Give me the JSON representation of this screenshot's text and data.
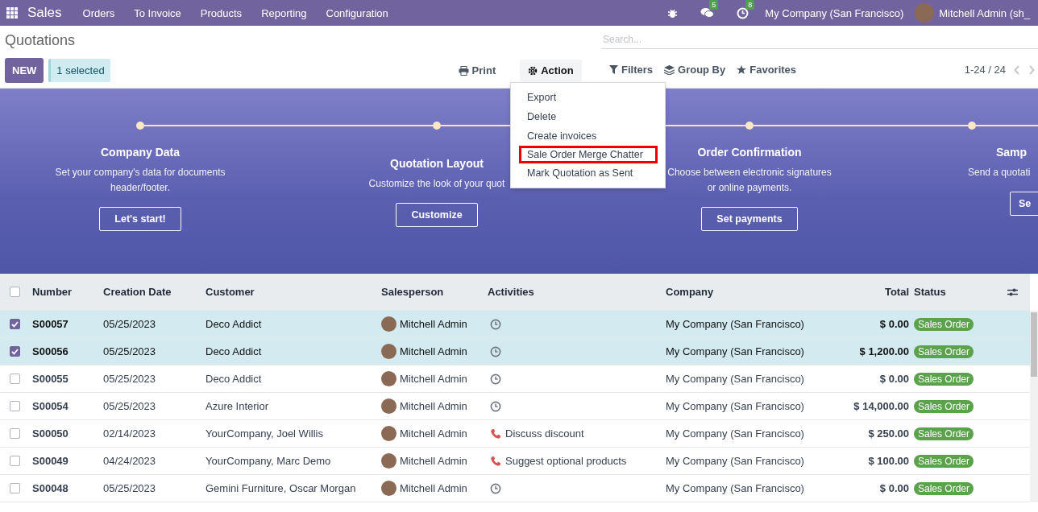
{
  "navbar": {
    "app": "Sales",
    "menus": [
      "Orders",
      "To Invoice",
      "Products",
      "Reporting",
      "Configuration"
    ],
    "messages_badge": "5",
    "activities_badge": "8",
    "company": "My Company (San Francisco)",
    "user": "Mitchell Admin (sh_"
  },
  "control_panel": {
    "title": "Quotations",
    "new_button": "NEW",
    "selection": "1 selected",
    "print": "Print",
    "action": "Action",
    "search": {
      "placeholder": "Search..."
    },
    "filters": "Filters",
    "group_by": "Group By",
    "favorites": "Favorites",
    "pager": "1-24 / 24"
  },
  "action_menu": [
    {
      "label": "Export",
      "outlined": false
    },
    {
      "label": "Delete",
      "outlined": false
    },
    {
      "label": "Create invoices",
      "outlined": false
    },
    {
      "label": "Sale Order Merge Chatter",
      "outlined": true
    },
    {
      "label": "Mark Quotation as Sent",
      "outlined": false
    }
  ],
  "onboarding": [
    {
      "title": "Company Data",
      "description": "Set your company's data for documents header/footer.",
      "button": "Let's start!"
    },
    {
      "title": "Quotation Layout",
      "description": "Customize the look of your quot",
      "button": "Customize"
    },
    {
      "title": "Order Confirmation",
      "description": "Choose between electronic signatures or online payments.",
      "button": "Set payments"
    },
    {
      "title": "Samp",
      "description": "Send a quotati",
      "button": "Se"
    }
  ],
  "table": {
    "columns": [
      "Number",
      "Creation Date",
      "Customer",
      "Salesperson",
      "Activities",
      "Company",
      "Total",
      "Status"
    ],
    "all_checked": false,
    "rows": [
      {
        "number": "S00057",
        "date": "05/25/2023",
        "customer": "Deco Addict",
        "salesperson": "Mitchell Admin",
        "kind": "clock",
        "activity": "",
        "company": "My Company (San Francisco)",
        "total": "$ 0.00",
        "status": "Sales Order",
        "checked": true,
        "selected": true
      },
      {
        "number": "S00056",
        "date": "05/25/2023",
        "customer": "Deco Addict",
        "salesperson": "Mitchell Admin",
        "kind": "clock",
        "activity": "",
        "company": "My Company (San Francisco)",
        "total": "$ 1,200.00",
        "status": "Sales Order",
        "checked": true,
        "selected": true
      },
      {
        "number": "S00055",
        "date": "05/25/2023",
        "customer": "Deco Addict",
        "salesperson": "Mitchell Admin",
        "kind": "clock",
        "activity": "",
        "company": "My Company (San Francisco)",
        "total": "$ 0.00",
        "status": "Sales Order",
        "checked": false,
        "selected": false
      },
      {
        "number": "S00054",
        "date": "05/25/2023",
        "customer": "Azure Interior",
        "salesperson": "Mitchell Admin",
        "kind": "clock",
        "activity": "",
        "company": "My Company (San Francisco)",
        "total": "$ 14,000.00",
        "status": "Sales Order",
        "checked": false,
        "selected": false
      },
      {
        "number": "S00050",
        "date": "02/14/2023",
        "customer": "YourCompany, Joel Willis",
        "salesperson": "Mitchell Admin",
        "kind": "phone",
        "activity": "Discuss discount",
        "company": "My Company (San Francisco)",
        "total": "$ 250.00",
        "status": "Sales Order",
        "checked": false,
        "selected": false
      },
      {
        "number": "S00049",
        "date": "04/24/2023",
        "customer": "YourCompany, Marc Demo",
        "salesperson": "Mitchell Admin",
        "kind": "phone",
        "activity": "Suggest optional products",
        "company": "My Company (San Francisco)",
        "total": "$ 100.00",
        "status": "Sales Order",
        "checked": false,
        "selected": false
      },
      {
        "number": "S00048",
        "date": "05/25/2023",
        "customer": "Gemini Furniture, Oscar Morgan",
        "salesperson": "Mitchell Admin",
        "kind": "clock",
        "activity": "",
        "company": "My Company (San Francisco)",
        "total": "$ 0.00",
        "status": "Sales Order",
        "checked": false,
        "selected": false
      }
    ]
  }
}
